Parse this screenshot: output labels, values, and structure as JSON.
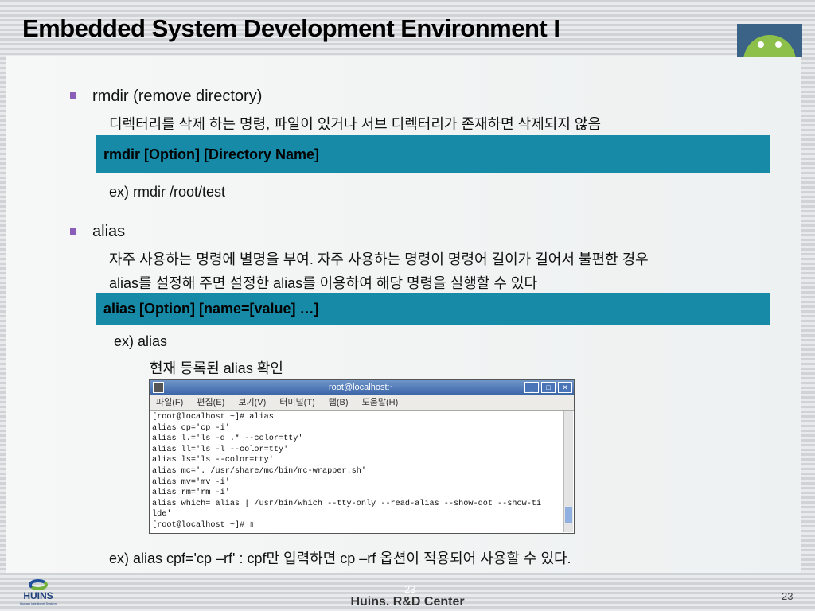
{
  "title": "Embedded System Development Environment I",
  "sections": [
    {
      "heading": "rmdir (remove directory)",
      "desc": [
        "디렉터리를 삭제 하는 명령, 파일이 있거나 서브 디렉터리가 존재하면 삭제되지 않음"
      ],
      "syntax": "rmdir [Option] [Directory Name]",
      "example": "ex) rmdir /root/test"
    },
    {
      "heading": "alias",
      "desc": [
        "자주 사용하는 명령에 별명을 부여. 자주 사용하는 명령이 명령어 길이가 길어서 불편한 경우",
        "alias를 설정해 주면 설정한 alias를 이용하여 해당 명령을 실행할 수 있다"
      ],
      "syntax": "alias [Option] [name=[value] …]",
      "example": "ex) alias",
      "example_note": "현재 등록된 alias 확인"
    }
  ],
  "terminal": {
    "title": "root@localhost:~",
    "menu": [
      "파일(F)",
      "편집(E)",
      "보기(V)",
      "터미널(T)",
      "탭(B)",
      "도움말(H)"
    ],
    "output": "[root@localhost ~]# alias\nalias cp='cp -i'\nalias l.='ls -d .* --color=tty'\nalias ll='ls -l --color=tty'\nalias ls='ls --color=tty'\nalias mc='. /usr/share/mc/bin/mc-wrapper.sh'\nalias mv='mv -i'\nalias rm='rm -i'\nalias which='alias | /usr/bin/which --tty-only --read-alias --show-dot --show-ti\nlde'\n[root@localhost ~]# ▯"
  },
  "final_example": "ex) alias cpf='cp –rf'   : cpf만 입력하면 cp –rf 옵션이 적용되어 사용할 수 있다.",
  "footer": {
    "center": "Huins. R&D Center",
    "page_ghost": "- 23 -",
    "page": "23",
    "logo_text": "HUINS",
    "logo_sub": "Human Intelligent System"
  },
  "colors": {
    "syntax_box": "#178aa8",
    "bullet": "#8a5db8"
  }
}
